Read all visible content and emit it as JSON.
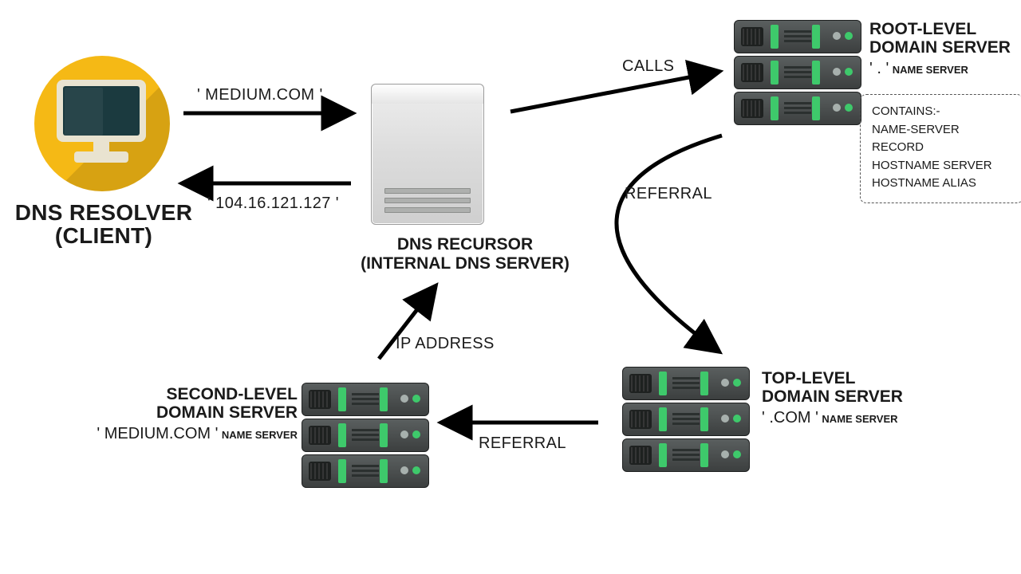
{
  "nodes": {
    "client": {
      "title_line1": "DNS RESOLVER",
      "title_line2": "(CLIENT)"
    },
    "recursor": {
      "title_line1": "DNS RECURSOR",
      "title_line2": "(INTERNAL DNS SERVER)"
    },
    "root": {
      "title_line1": "ROOT-LEVEL",
      "title_line2": "DOMAIN SERVER",
      "scope_quoted": "' . '",
      "scope_sub": "NAME SERVER",
      "box_line1": "CONTAINS:-",
      "box_line2": "NAME-SERVER RECORD",
      "box_line3": "HOSTNAME SERVER",
      "box_line4": "HOSTNAME ALIAS"
    },
    "tld": {
      "title_line1": "TOP-LEVEL",
      "title_line2": "DOMAIN SERVER",
      "scope_quoted": "' .COM '",
      "scope_sub": "NAME SERVER"
    },
    "sld": {
      "title_line1": "SECOND-LEVEL",
      "title_line2": "DOMAIN SERVER",
      "scope_quoted": "' MEDIUM.COM '",
      "scope_sub": "NAME SERVER"
    }
  },
  "edges": {
    "client_to_recursor": {
      "label": "' MEDIUM.COM '"
    },
    "recursor_to_client": {
      "label": "' 104.16.121.127 '"
    },
    "recursor_to_root": {
      "label": "CALLS"
    },
    "root_to_tld": {
      "label": "REFERRAL"
    },
    "tld_to_sld": {
      "label": "REFERRAL"
    },
    "sld_to_recursor": {
      "label": "IP ADDRESS"
    }
  }
}
